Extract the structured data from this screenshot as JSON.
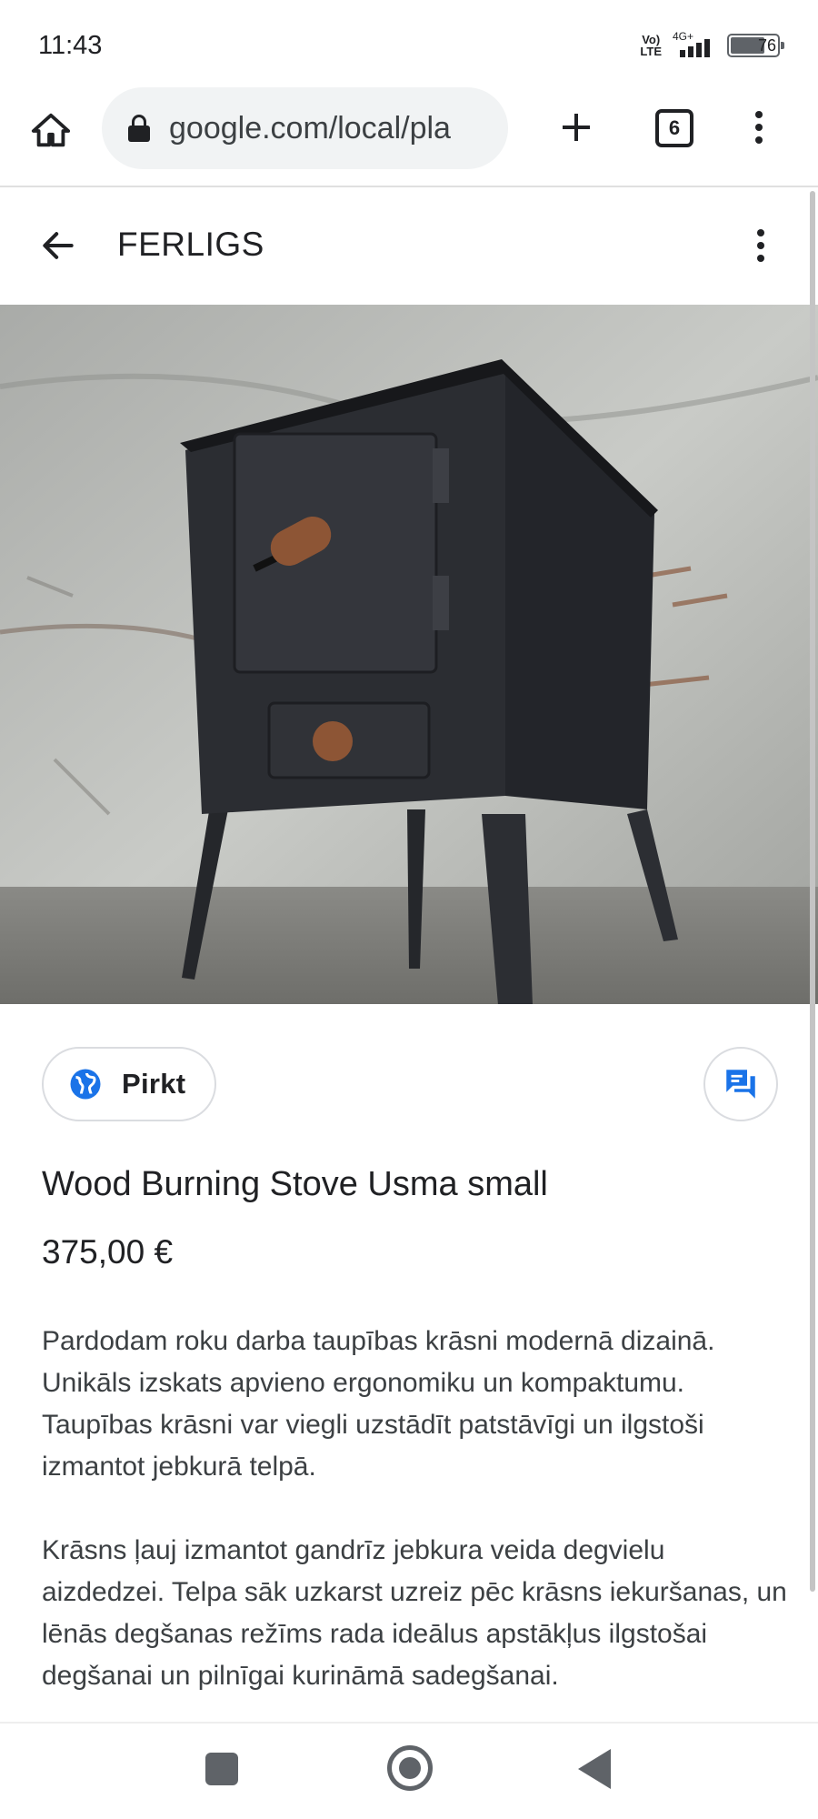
{
  "status_bar": {
    "time": "11:43",
    "volte_line1": "Vo)",
    "volte_line2": "LTE",
    "network_label": "4G+",
    "battery_level": "76",
    "battery_fraction": 0.76
  },
  "browser": {
    "url": "google.com/local/pla",
    "tab_count": "6",
    "icons": {
      "home": "home-icon",
      "lock": "lock-icon",
      "new_tab": "plus-icon",
      "menu": "more-vert-icon"
    }
  },
  "header": {
    "title": "FERLIGS",
    "icons": {
      "back": "arrow-back-icon",
      "menu": "more-vert-icon"
    }
  },
  "product": {
    "image_alt": "Wood burning stove",
    "buy_label": "Pirkt",
    "buy_icon": "globe-icon",
    "chat_icon": "chat-icon",
    "title": "Wood Burning Stove Usma small",
    "price": "375,00 €",
    "description": [
      "Pardodam roku darba taupības krāsni modernā dizainā. Unikāls izskats apvieno ergonomiku un kompaktumu. Taupības krāsni var viegli uzstādīt patstāvīgi un ilgstoši izmantot jebkurā telpā.",
      "Krāsns ļauj izmantot gandrīz jebkura veida degvielu aizdedzei. Telpa sāk uzkarst uzreiz pēc krāsns iekuršanas, un lēnās degšanas režīms rada ideālus apstākļus ilgstošai degšanai un pilnīgai kurināmā sadegšanai."
    ]
  },
  "colors": {
    "accent_blue": "#1a73e8",
    "text_primary": "#202124",
    "text_secondary": "#3c4043",
    "border": "#dadce0"
  },
  "nav": {
    "icons": {
      "recents": "square-icon",
      "home": "circle-icon",
      "back": "triangle-back-icon"
    }
  }
}
